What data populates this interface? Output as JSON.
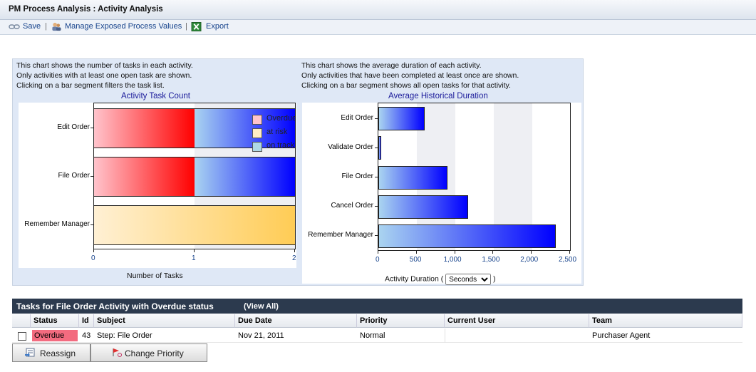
{
  "window": {
    "title": "PM Process Analysis : Activity Analysis"
  },
  "toolbar": {
    "save_label": "Save",
    "manage_label": "Manage Exposed Process Values",
    "export_label": "Export",
    "separator": "|"
  },
  "task_count_chart": {
    "desc": [
      "This chart shows the number of tasks in each activity.",
      "Only activities with at least one open task are shown.",
      "Clicking on a bar segment filters the task list."
    ]
  },
  "duration_chart": {
    "desc": [
      "This chart shows the average duration of each activity.",
      "Only activities that have been completed at least once are shown.",
      "Clicking on a bar segment shows all open tasks for that activity."
    ],
    "unit_prefix": "Activity Duration (",
    "unit_suffix": ")",
    "unit_selected": "Seconds"
  },
  "chart_data": [
    {
      "type": "bar",
      "orientation": "horizontal",
      "stacked": true,
      "title": "Activity Task Count",
      "xlabel": "Number of Tasks",
      "categories": [
        "Edit Order",
        "File Order",
        "Remember Manager"
      ],
      "series": [
        {
          "name": "Overdue",
          "values": [
            1,
            1,
            0
          ],
          "color": "#ff0000"
        },
        {
          "name": "at risk",
          "values": [
            0,
            0,
            2
          ],
          "color": "#ffcc55"
        },
        {
          "name": "on track",
          "values": [
            1,
            1,
            0
          ],
          "color": "#0000ff"
        }
      ],
      "xlim": [
        0,
        2
      ],
      "xticks": [
        "0",
        "1",
        "2"
      ],
      "legend_position": "top-right"
    },
    {
      "type": "bar",
      "orientation": "horizontal",
      "title": "Average Historical Duration",
      "xlabel": "Activity Duration (Seconds)",
      "categories": [
        "Edit Order",
        "Validate Order",
        "File Order",
        "Cancel Order",
        "Remember Manager"
      ],
      "values": [
        600,
        40,
        900,
        1170,
        2310
      ],
      "xlim": [
        0,
        2500
      ],
      "xticks": [
        "0",
        "500",
        "1,000",
        "1,500",
        "2,000",
        "2,500"
      ]
    }
  ],
  "task_grid": {
    "title": "Tasks for File Order Activity with Overdue status",
    "view_all": "(View All)",
    "columns": [
      "Status",
      "Id",
      "Subject",
      "Due Date",
      "Priority",
      "Current User",
      "Team"
    ],
    "rows": [
      {
        "status": "Overdue",
        "id": "43",
        "subject": "Step: File Order",
        "due_date": "Nov 21, 2011",
        "priority": "Normal",
        "current_user": "",
        "team": "Purchaser Agent"
      }
    ]
  },
  "buttons": {
    "reassign": "Reassign",
    "change_priority": "Change Priority"
  },
  "colors": {
    "overdue_badge": "#f36b7f",
    "grid_header": "#2c3a4e",
    "chart_title": "#1a1a9a"
  }
}
